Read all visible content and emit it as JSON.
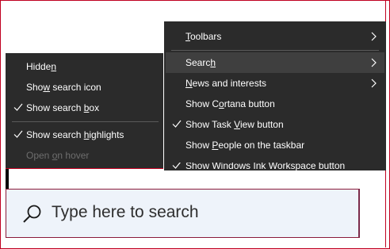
{
  "main_menu": {
    "toolbars": {
      "pre": "",
      "u": "T",
      "post": "oolbars"
    },
    "search": {
      "pre": "Searc",
      "u": "h",
      "post": ""
    },
    "news": {
      "pre": "",
      "u": "N",
      "post": "ews and interests"
    },
    "cortana": {
      "pre": "Show C",
      "u": "o",
      "post": "rtana button"
    },
    "taskview": {
      "pre": "Show Task ",
      "u": "V",
      "post": "iew button"
    },
    "people": {
      "pre": "Show ",
      "u": "P",
      "post": "eople on the taskbar"
    },
    "ink": {
      "pre": "Show Windows Ink Workspace button",
      "u": "",
      "post": ""
    }
  },
  "sub_menu": {
    "hidden": {
      "pre": "Hidde",
      "u": "n",
      "post": ""
    },
    "icon": {
      "pre": "Sho",
      "u": "w",
      "post": " search icon"
    },
    "box": {
      "pre": "Show search ",
      "u": "b",
      "post": "ox"
    },
    "highlights": {
      "pre": "Show search ",
      "u": "h",
      "post": "ighlights"
    },
    "hover": {
      "pre": "Open ",
      "u": "o",
      "post": "n hover"
    }
  },
  "search_box": {
    "placeholder": "Type here to search"
  },
  "colors": {
    "menu_bg": "#2b2b2b",
    "highlight": "#3f3f3f",
    "search_bg": "#eef3fa",
    "frame": "#c00020"
  }
}
